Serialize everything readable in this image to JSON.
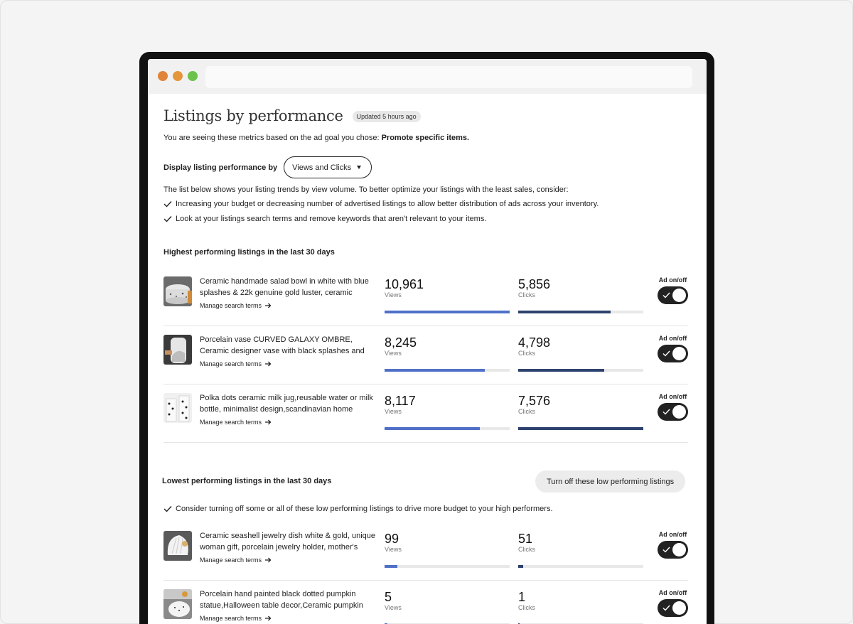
{
  "page": {
    "title": "Listings by performance",
    "updated_badge": "Updated 5 hours ago",
    "goal_prefix": "You are seeing these metrics based on the ad goal you chose: ",
    "goal_value": "Promote specific items.",
    "display_label": "Display listing performance by",
    "display_selected": "Views and Clicks",
    "intro": "The list below shows your listing trends by view volume. To better optimize your listings with the least sales, consider:",
    "tips": [
      "Increasing your budget or decreasing number of advertised listings to allow better distribution of ads across your inventory.",
      "Look at your listings search terms and remove keywords that aren't relevant to your items."
    ]
  },
  "highest": {
    "title": "Highest performing listings in the last 30 days",
    "listings": [
      {
        "title": "Ceramic handmade salad bowl in white with blue splashes & 22k genuine gold luster, ceramic servi…",
        "manage": "Manage search terms",
        "views": "10,961",
        "views_label": "Views",
        "views_pct": 100,
        "clicks": "5,856",
        "clicks_label": "Clicks",
        "clicks_pct": 74,
        "ad_label": "Ad on/off",
        "ad_on": true
      },
      {
        "title": "Porcelain vase CURVED GALAXY OMBRE, Ceramic designer vase with black splashes and ombre effe…",
        "manage": "Manage search terms",
        "views": "8,245",
        "views_label": "Views",
        "views_pct": 80,
        "clicks": "4,798",
        "clicks_label": "Clicks",
        "clicks_pct": 69,
        "ad_label": "Ad on/off",
        "ad_on": true
      },
      {
        "title": "Polka dots ceramic milk jug,reusable water or milk bottle, minimalist design,scandinavian home deco…",
        "manage": "Manage search terms",
        "views": "8,117",
        "views_label": "Views",
        "views_pct": 76,
        "clicks": "7,576",
        "clicks_label": "Clicks",
        "clicks_pct": 100,
        "ad_label": "Ad on/off",
        "ad_on": true
      }
    ]
  },
  "lowest": {
    "title": "Lowest performing listings in the last 30 days",
    "turn_off_button": "Turn off these low performing listings",
    "tip": "Consider turning off some or all of these low performing listings to drive more budget to your high performers.",
    "listings": [
      {
        "title": "Ceramic seashell jewelry dish white & gold, unique woman gift, porcelain jewelry holder, mother's day…",
        "manage": "Manage search terms",
        "views": "99",
        "views_label": "Views",
        "views_pct": 10,
        "clicks": "51",
        "clicks_label": "Clicks",
        "clicks_pct": 4,
        "ad_label": "Ad on/off",
        "ad_on": true
      },
      {
        "title": "Porcelain hand painted black dotted pumpkin statue,Halloween table decor,Ceramic pumpkin fa…",
        "manage": "Manage search terms",
        "views": "5",
        "views_label": "Views",
        "views_pct": 2,
        "clicks": "1",
        "clicks_label": "Clicks",
        "clicks_pct": 1,
        "ad_label": "Ad on/off",
        "ad_on": true
      }
    ]
  },
  "colors": {
    "views_bar": "#5070c7",
    "clicks_bar": "#2d426e",
    "toggle_on": "#222222"
  }
}
